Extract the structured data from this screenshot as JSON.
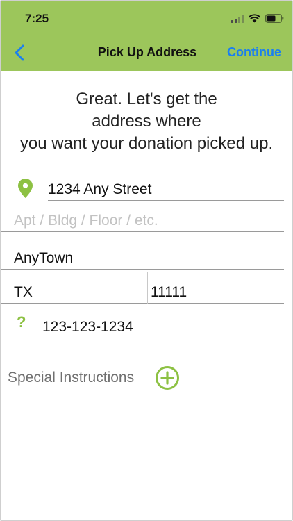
{
  "status_bar": {
    "time": "7:25"
  },
  "nav": {
    "title": "Pick Up Address",
    "continue_label": "Continue"
  },
  "intro": {
    "line1": "Great.  Let's get the",
    "line2": "address where",
    "line3": "you want your donation picked up."
  },
  "form": {
    "street": {
      "value": "1234 Any Street"
    },
    "apt": {
      "placeholder": "Apt / Bldg / Floor / etc."
    },
    "city": {
      "value": "AnyTown"
    },
    "state": {
      "value": "TX"
    },
    "zip": {
      "value": "11111"
    },
    "phone": {
      "value": "123-123-1234"
    },
    "help_symbol": "?"
  },
  "special_instructions": {
    "label": "Special Instructions"
  },
  "colors": {
    "header_bg": "#9cc65b",
    "accent_green": "#8dc143",
    "link_blue": "#1a7ff0"
  },
  "icons": [
    "back-chevron-icon",
    "location-pin-icon",
    "help-icon",
    "add-circle-icon",
    "signal-icon",
    "wifi-icon",
    "battery-icon"
  ]
}
